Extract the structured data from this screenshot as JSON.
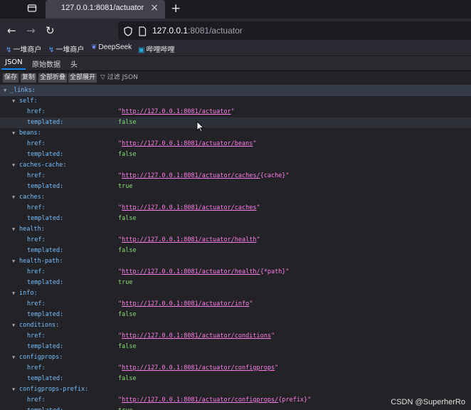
{
  "browser": {
    "tab_title": "127.0.0.1:8081/actuator",
    "url_host": "127.0.0.1",
    "url_rest": ":8081/actuator",
    "bookmarks": [
      {
        "label": "一堆商户",
        "icon": "link-icon"
      },
      {
        "label": "一堆商户",
        "icon": "link-icon"
      },
      {
        "label": "DeepSeek",
        "icon": "deepseek-icon"
      },
      {
        "label": "哔哩哔哩",
        "icon": "bilibili-icon"
      }
    ]
  },
  "viewer": {
    "tabs": [
      "JSON",
      "原始数据",
      "头"
    ],
    "buttons": [
      "保存",
      "复制",
      "全部折叠",
      "全部展开"
    ],
    "filter_label": "过滤 JSON"
  },
  "tree": {
    "root_key": "_links:",
    "href_key": "href:",
    "templated_key": "templated:",
    "links": [
      {
        "name": "self:",
        "href_prefix": "http://127.0.0.1:8081/actuator",
        "href_suffix": "",
        "templated": "false"
      },
      {
        "name": "beans:",
        "href_prefix": "http://127.0.0.1:8081/actuator/beans",
        "href_suffix": "",
        "templated": "false"
      },
      {
        "name": "caches-cache:",
        "href_prefix": "http://127.0.0.1:8081/actuator/caches/",
        "href_suffix": "{cache}",
        "templated": "true"
      },
      {
        "name": "caches:",
        "href_prefix": "http://127.0.0.1:8081/actuator/caches",
        "href_suffix": "",
        "templated": "false"
      },
      {
        "name": "health:",
        "href_prefix": "http://127.0.0.1:8081/actuator/health",
        "href_suffix": "",
        "templated": "false"
      },
      {
        "name": "health-path:",
        "href_prefix": "http://127.0.0.1:8081/actuator/health/",
        "href_suffix": "{*path}",
        "templated": "true"
      },
      {
        "name": "info:",
        "href_prefix": "http://127.0.0.1:8081/actuator/info",
        "href_suffix": "",
        "templated": "false"
      },
      {
        "name": "conditions:",
        "href_prefix": "http://127.0.0.1:8081/actuator/conditions",
        "href_suffix": "",
        "templated": "false"
      },
      {
        "name": "configprops:",
        "href_prefix": "http://127.0.0.1:8081/actuator/configprops",
        "href_suffix": "",
        "templated": "false"
      },
      {
        "name": "configprops-prefix:",
        "href_prefix": "http://127.0.0.1:8081/actuator/configprops/",
        "href_suffix": "{prefix}",
        "templated": "true"
      }
    ]
  },
  "watermark": "CSDN @SuperherRo",
  "colors": {
    "key": "#75bfff",
    "string": "#ff7de9",
    "boolean": "#86de74",
    "accent": "#0a84ff"
  }
}
